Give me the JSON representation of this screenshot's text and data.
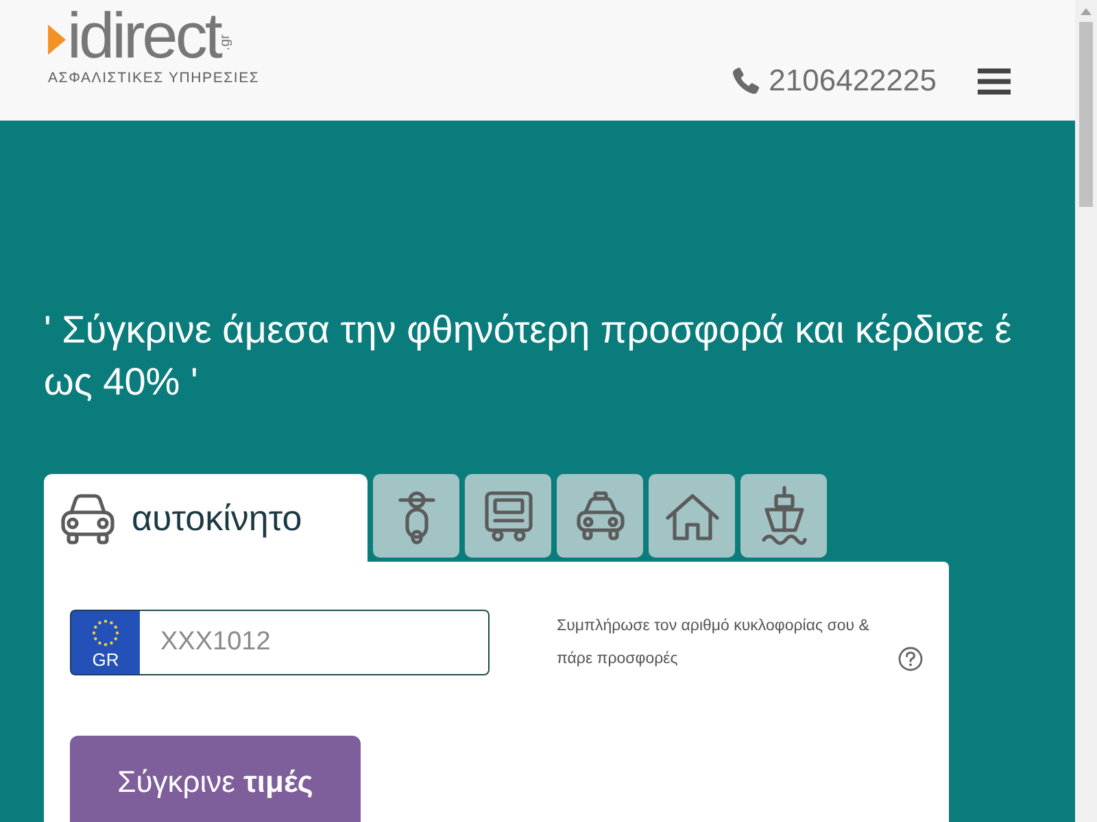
{
  "header": {
    "logo": {
      "name": "idirect",
      "domain": ".gr",
      "tagline": "ΑΣΦΑΛΙΣΤΙΚΕΣ ΥΠΗΡΕΣΙΕΣ"
    },
    "phone": "2106422225"
  },
  "hero": {
    "headline": "' Σύγκρινε άμεσα την φθηνότερη προσφορά και κέρδισε έ ως 40% '"
  },
  "tabs": [
    {
      "kind": "car",
      "label": "αυτοκίνητο",
      "selected": true
    },
    {
      "kind": "scooter",
      "selected": false
    },
    {
      "kind": "truck",
      "selected": false
    },
    {
      "kind": "taxi",
      "selected": false
    },
    {
      "kind": "house",
      "selected": false
    },
    {
      "kind": "ship",
      "selected": false
    }
  ],
  "form": {
    "plate": {
      "country": "GR",
      "placeholder": "XXX1012"
    },
    "hint": "Συμπλήρωσε τον αριθμό κυκλοφορίας σου & πάρε προσφορές",
    "button": "Σύγκρινε **τιμές**"
  }
}
